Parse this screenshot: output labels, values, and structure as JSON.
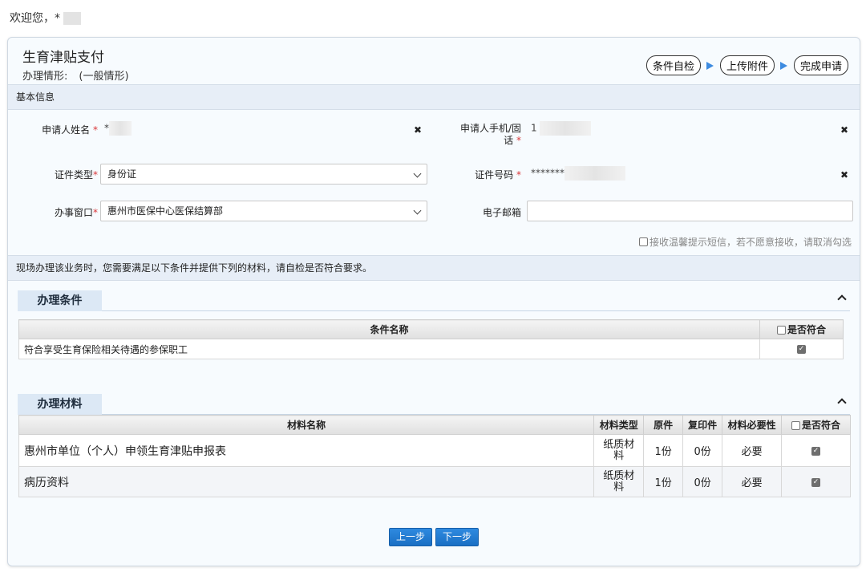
{
  "welcome": "欢迎您，*",
  "title": "生育津贴支付",
  "subtitle": {
    "label": "办理情形:",
    "value": "(一般情形)"
  },
  "steps": [
    "条件自检",
    "上传附件",
    "完成申请"
  ],
  "basic_info": "基本信息",
  "fields": {
    "name_label": "申请人姓名",
    "name_value": "*",
    "phone_label_1": "申请人手机/固",
    "phone_label_2": "话",
    "phone_value": "1",
    "idtype_label": "证件类型",
    "idtype_value": "身份证",
    "idno_label": "证件号码",
    "idno_value": "*******",
    "window_label": "办事窗口",
    "window_value": "惠州市医保中心医保结算部",
    "email_label": "电子邮箱",
    "email_value": "",
    "req_mark": "*",
    "clear_glyph": "✖"
  },
  "sms_notice": "接收温馨提示短信，若不愿意接收，请取消勾选",
  "notice": "现场办理该业务时，您需要满足以下条件并提供下列的材料，请自检是否符合要求。",
  "conditions": {
    "title": "办理条件",
    "headers": [
      "条件名称",
      "是否符合"
    ],
    "rows": [
      {
        "name": "符合享受生育保险相关待遇的参保职工",
        "checked": true
      }
    ]
  },
  "materials": {
    "title": "办理材料",
    "headers": [
      "材料名称",
      "材料类型",
      "原件",
      "复印件",
      "材料必要性",
      "是否符合"
    ],
    "rows": [
      {
        "name": "惠州市单位（个人）申领生育津贴申报表",
        "type": "纸质材料",
        "original": "1份",
        "copy": "0份",
        "necessity": "必要",
        "checked": true
      },
      {
        "name": "病历资料",
        "type": "纸质材料",
        "original": "1份",
        "copy": "0份",
        "necessity": "必要",
        "checked": true
      }
    ]
  },
  "buttons": {
    "prev": "上一步",
    "next": "下一步"
  },
  "colors": {
    "accent": "#1a6fc4",
    "required": "#d9383a",
    "section_bg": "#e7eef7"
  }
}
